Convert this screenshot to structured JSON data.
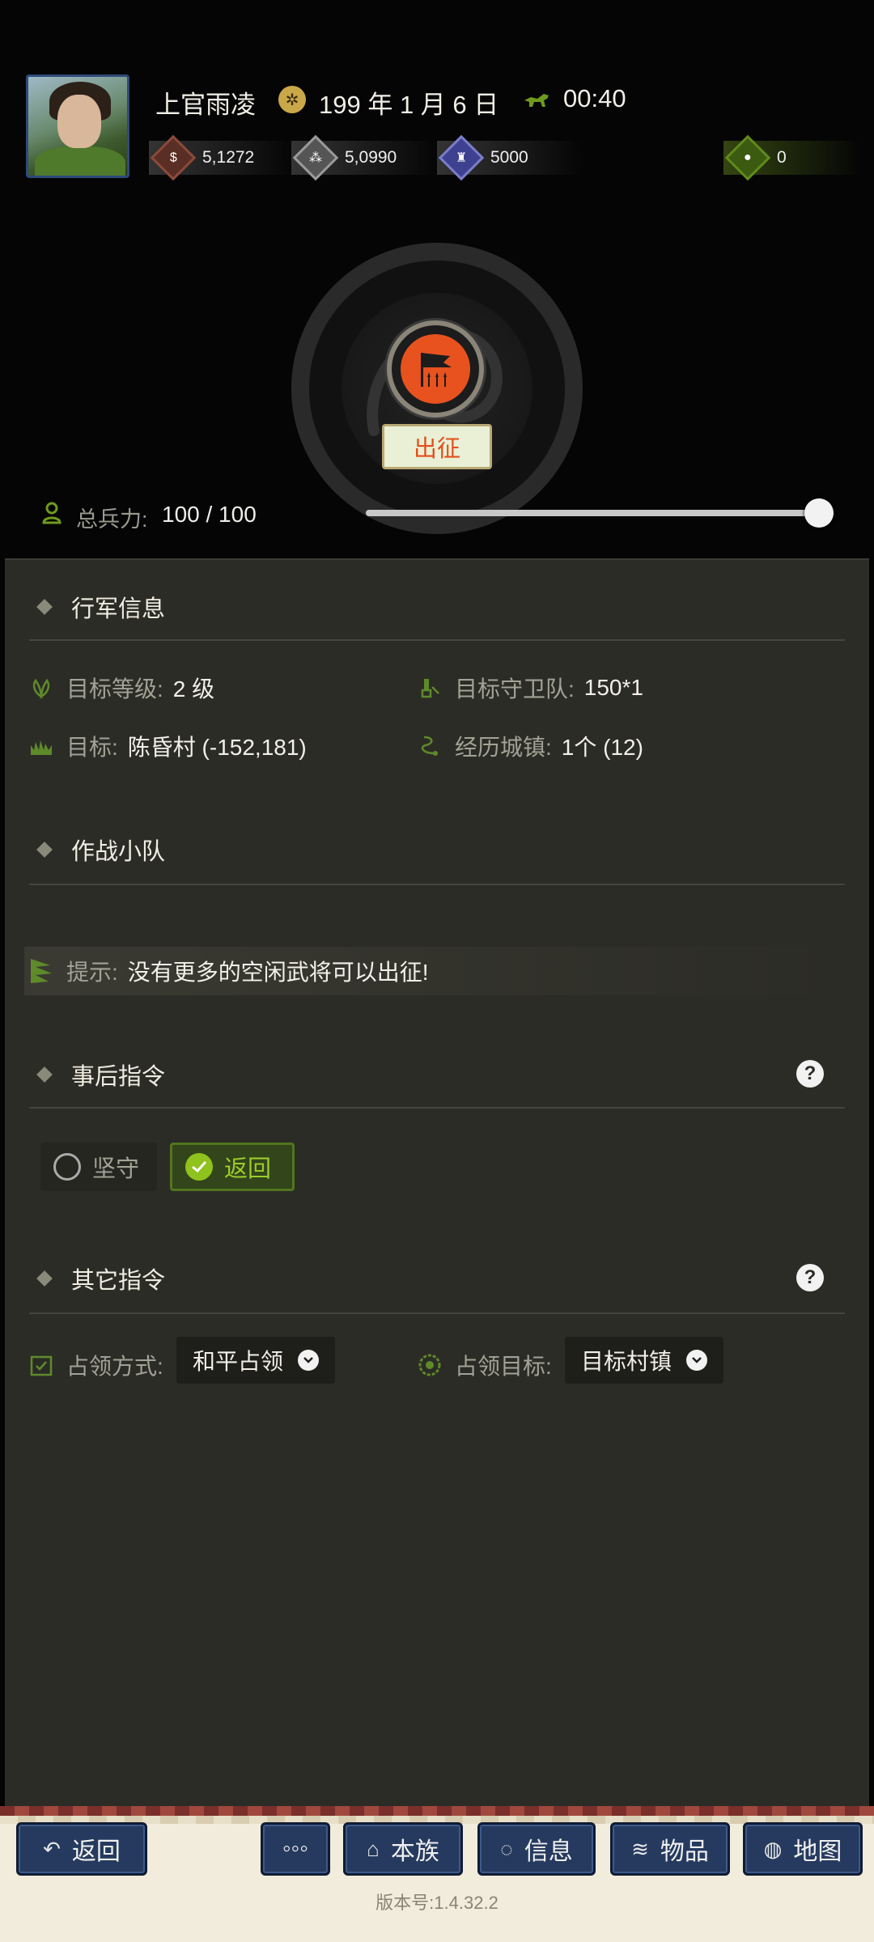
{
  "header": {
    "player_name": "上官雨凌",
    "date_icon": "calendar-seal-icon",
    "date": "199 年 1 月 6 日",
    "time_icon": "horse-icon",
    "time": "00:40",
    "resources": [
      {
        "icon": "coin-icon",
        "value": "5,1272",
        "color": "#8b4a3a"
      },
      {
        "icon": "grain-icon",
        "value": "5,0990",
        "color": "#9a9a9a"
      },
      {
        "icon": "soldier-icon",
        "value": "5000",
        "color": "#5b5ea8"
      },
      {
        "icon": "pouch-icon",
        "value": "0",
        "color": "#5f8a1c"
      }
    ]
  },
  "march": {
    "button_icon": "battle-flag-icon",
    "button_label": "出征"
  },
  "troops": {
    "label": "总兵力:",
    "value": "100 / 100",
    "slider_fraction": 1.0
  },
  "sections": {
    "march_info": {
      "title": "行军信息",
      "target_level_label": "目标等级:",
      "target_level_value": "2 级",
      "target_guard_label": "目标守卫队:",
      "target_guard_value": "150*1",
      "target_label": "目标:",
      "target_value": "陈昏村 (-152,181)",
      "towns_label": "经历城镇:",
      "towns_value": "1个 (12)"
    },
    "squad": {
      "title": "作战小队",
      "hint_label": "提示:",
      "hint_text": "没有更多的空闲武将可以出征!"
    },
    "after_orders": {
      "title": "事后指令",
      "help": "?",
      "options": [
        {
          "label": "坚守",
          "selected": false
        },
        {
          "label": "返回",
          "selected": true
        }
      ]
    },
    "other_orders": {
      "title": "其它指令",
      "help": "?",
      "occupy_mode_label": "占领方式:",
      "occupy_mode_value": "和平占领",
      "occupy_target_label": "占领目标:",
      "occupy_target_value": "目标村镇"
    }
  },
  "bottom_nav": {
    "back": "返回",
    "more": "◦◦◦",
    "clan": "本族",
    "info": "信息",
    "items": "物品",
    "map": "地图"
  },
  "version": "版本号:1.4.32.2"
}
